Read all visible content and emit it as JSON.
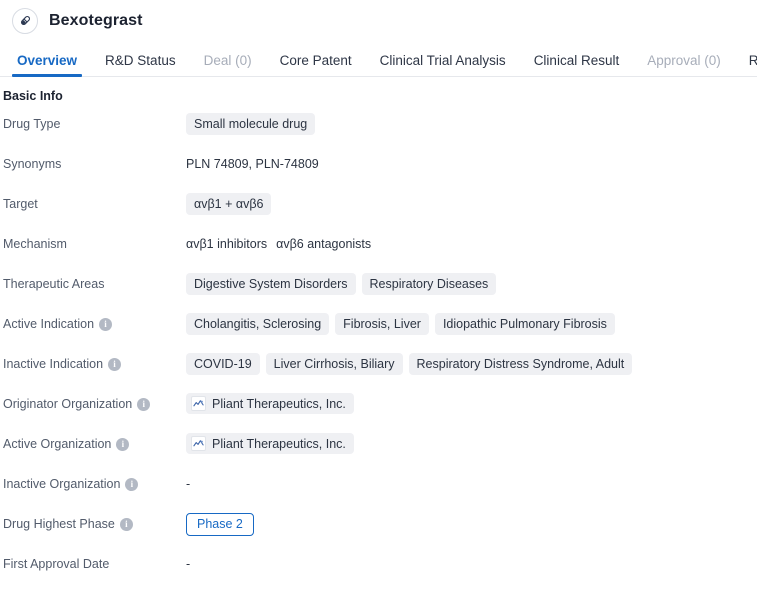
{
  "header": {
    "icon": "pill-icon",
    "title": "Bexotegrast"
  },
  "tabs": [
    {
      "label": "Overview",
      "state": "active"
    },
    {
      "label": "R&D Status",
      "state": "normal"
    },
    {
      "label": "Deal (0)",
      "state": "disabled"
    },
    {
      "label": "Core Patent",
      "state": "normal"
    },
    {
      "label": "Clinical Trial Analysis",
      "state": "normal"
    },
    {
      "label": "Clinical Result",
      "state": "normal"
    },
    {
      "label": "Approval (0)",
      "state": "disabled"
    },
    {
      "label": "Regulation",
      "state": "normal"
    }
  ],
  "basic_info": {
    "section_title": "Basic Info",
    "rows": [
      {
        "label": "Drug Type",
        "info_icon": false,
        "type": "chips",
        "values": [
          "Small molecule drug"
        ]
      },
      {
        "label": "Synonyms",
        "info_icon": false,
        "type": "text",
        "values": [
          "PLN 74809,  PLN-74809"
        ]
      },
      {
        "label": "Target",
        "info_icon": false,
        "type": "chips",
        "values": [
          "αvβ1 + αvβ6"
        ]
      },
      {
        "label": "Mechanism",
        "info_icon": false,
        "type": "text-group",
        "values": [
          "αvβ1 inhibitors",
          "αvβ6 antagonists"
        ]
      },
      {
        "label": "Therapeutic Areas",
        "info_icon": false,
        "type": "chips",
        "values": [
          "Digestive System Disorders",
          "Respiratory Diseases"
        ]
      },
      {
        "label": "Active Indication",
        "info_icon": true,
        "type": "chips",
        "values": [
          "Cholangitis, Sclerosing",
          "Fibrosis, Liver",
          "Idiopathic Pulmonary Fibrosis"
        ]
      },
      {
        "label": "Inactive Indication",
        "info_icon": true,
        "type": "chips",
        "values": [
          "COVID-19",
          "Liver Cirrhosis, Biliary",
          "Respiratory Distress Syndrome, Adult"
        ]
      },
      {
        "label": "Originator Organization",
        "info_icon": true,
        "type": "org-chips",
        "values": [
          "Pliant Therapeutics, Inc."
        ]
      },
      {
        "label": "Active Organization",
        "info_icon": true,
        "type": "org-chips",
        "values": [
          "Pliant Therapeutics, Inc."
        ]
      },
      {
        "label": "Inactive Organization",
        "info_icon": true,
        "type": "dash",
        "values": [
          "-"
        ]
      },
      {
        "label": "Drug Highest Phase",
        "info_icon": true,
        "type": "phase-badge",
        "values": [
          "Phase 2"
        ]
      },
      {
        "label": "First Approval Date",
        "info_icon": false,
        "type": "dash",
        "values": [
          "-"
        ]
      }
    ]
  },
  "colors": {
    "accent": "#1769c4",
    "chip_bg": "#eff0f3",
    "label_text": "#525b6b",
    "value_text": "#2c3442",
    "disabled_tab": "#a7adb9",
    "border": "#e6e8ec"
  },
  "icons": {
    "info": "i",
    "pill": "pill-icon",
    "org_logo": "company-logo-icon"
  }
}
